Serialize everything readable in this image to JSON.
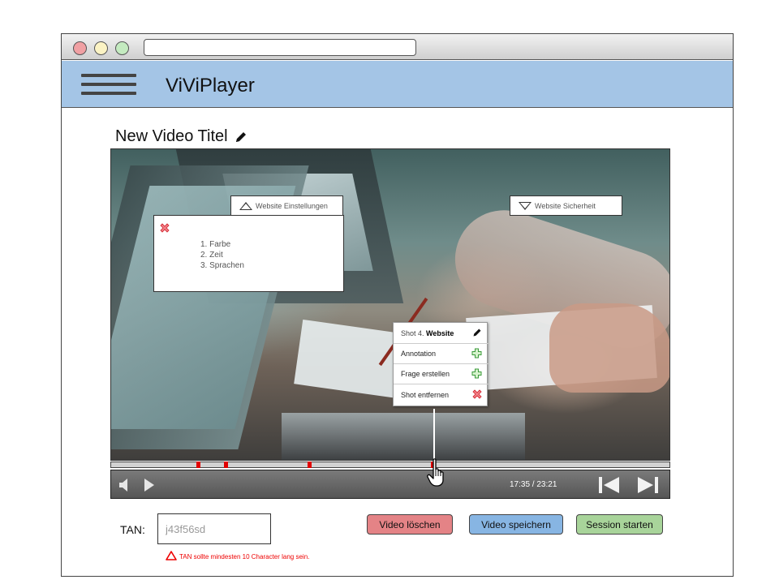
{
  "app": {
    "title": "ViViPlayer"
  },
  "video": {
    "title": "New Video Titel",
    "time": "17:35 / 23:21",
    "progress_markers": [
      0.155,
      0.205,
      0.355,
      0.575
    ],
    "playhead": 0.575
  },
  "overlays": {
    "einstellungen_label": "Website Einstellungen",
    "sicherheit_label": "Website Sicherheit",
    "settings_items": [
      "1. Farbe",
      "2. Zeit",
      "3. Sprachen"
    ]
  },
  "shot_menu": {
    "header_prefix": "Shot 4.",
    "header_name": "Website",
    "items": [
      {
        "label": "Annotation",
        "icon": "plus-icon"
      },
      {
        "label": "Frage erstellen",
        "icon": "plus-icon"
      },
      {
        "label": "Shot entfernen",
        "icon": "close-icon"
      }
    ]
  },
  "tan": {
    "label": "TAN:",
    "placeholder": "j43f56sd",
    "warning": "TAN sollte mindesten 10 Character lang sein."
  },
  "buttons": {
    "delete": "Video löschen",
    "save": "Video speichern",
    "session": "Session starten"
  },
  "colors": {
    "appbar": "#a4c5e6",
    "delete": "#e48386",
    "save": "#87b5e3",
    "session": "#a8d49a",
    "warning": "#e00000",
    "marker": "#e00000"
  }
}
